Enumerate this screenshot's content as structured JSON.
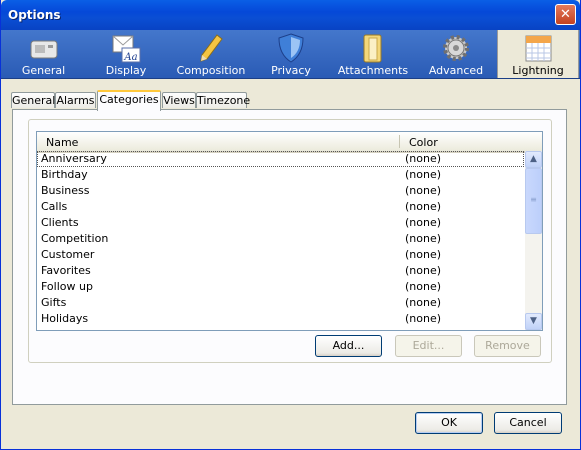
{
  "window": {
    "title": "Options"
  },
  "colors": {
    "titlebar": "#0a5fe6",
    "toolbar": "#2a5bb5",
    "dialog_face": "#ece9d8",
    "tab_highlight": "#ffc83c"
  },
  "panes": [
    {
      "label": "General",
      "icon": "general-pane-icon"
    },
    {
      "label": "Display",
      "icon": "display-pane-icon"
    },
    {
      "label": "Composition",
      "icon": "pencil-icon"
    },
    {
      "label": "Privacy",
      "icon": "shield-icon"
    },
    {
      "label": "Attachments",
      "icon": "paperclip-folder-icon"
    },
    {
      "label": "Advanced",
      "icon": "gear-icon"
    },
    {
      "label": "Lightning",
      "icon": "calendar-icon"
    }
  ],
  "tabs": [
    "General",
    "Alarms",
    "Categories",
    "Views",
    "Timezone"
  ],
  "selected_tab": "Categories",
  "list": {
    "columns": {
      "name": "Name",
      "color": "Color"
    },
    "rows": [
      {
        "name": "Anniversary",
        "color": "(none)"
      },
      {
        "name": "Birthday",
        "color": "(none)"
      },
      {
        "name": "Business",
        "color": "(none)"
      },
      {
        "name": "Calls",
        "color": "(none)"
      },
      {
        "name": "Clients",
        "color": "(none)"
      },
      {
        "name": "Competition",
        "color": "(none)"
      },
      {
        "name": "Customer",
        "color": "(none)"
      },
      {
        "name": "Favorites",
        "color": "(none)"
      },
      {
        "name": "Follow up",
        "color": "(none)"
      },
      {
        "name": "Gifts",
        "color": "(none)"
      },
      {
        "name": "Holidays",
        "color": "(none)"
      }
    ]
  },
  "buttons": {
    "add": "Add...",
    "edit": "Edit...",
    "remove": "Remove",
    "ok": "OK",
    "cancel": "Cancel"
  },
  "window_controls": {
    "close": "✕"
  },
  "scroll": {
    "up": "▲",
    "down": "▼",
    "grip": "≡"
  }
}
